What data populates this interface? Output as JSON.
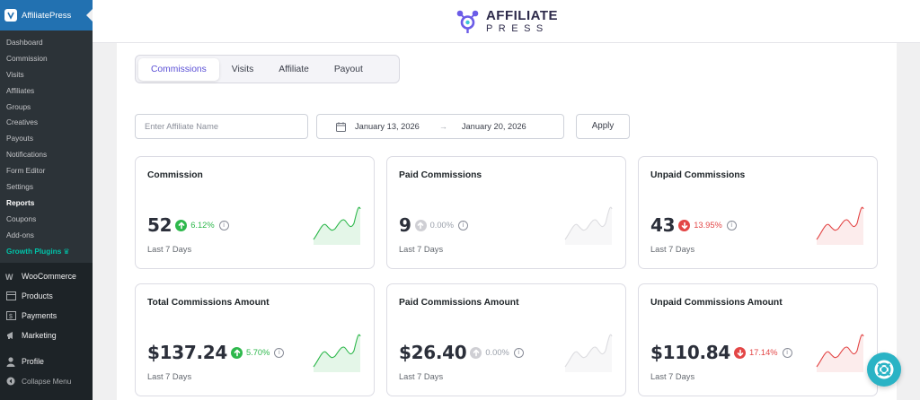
{
  "sidebar": {
    "plugin_title": "AffiliatePress",
    "submenu": [
      {
        "label": "Dashboard"
      },
      {
        "label": "Commission"
      },
      {
        "label": "Visits"
      },
      {
        "label": "Affiliates"
      },
      {
        "label": "Groups"
      },
      {
        "label": "Creatives"
      },
      {
        "label": "Payouts"
      },
      {
        "label": "Notifications"
      },
      {
        "label": "Form Editor"
      },
      {
        "label": "Settings"
      },
      {
        "label": "Reports"
      },
      {
        "label": "Coupons"
      },
      {
        "label": "Add-ons"
      },
      {
        "label": "Growth Plugins"
      }
    ],
    "menu": [
      {
        "label": "WooCommerce",
        "icon": "woocommerce-icon"
      },
      {
        "label": "Products",
        "icon": "products-icon"
      },
      {
        "label": "Payments",
        "icon": "payments-icon"
      },
      {
        "label": "Marketing",
        "icon": "megaphone-icon"
      },
      {
        "label": "Profile",
        "icon": "user-icon"
      },
      {
        "label": "Collapse Menu",
        "icon": "collapse-icon"
      }
    ]
  },
  "header": {
    "brand_line1": "AFFILIATE",
    "brand_line2": "PRESS"
  },
  "tabs": [
    {
      "label": "Commissions",
      "active": true
    },
    {
      "label": "Visits"
    },
    {
      "label": "Affiliate"
    },
    {
      "label": "Payout"
    }
  ],
  "filters": {
    "affiliate_placeholder": "Enter Affiliate Name",
    "start_date": "January 13, 2026",
    "end_date": "January 20, 2026",
    "apply_label": "Apply"
  },
  "cards": [
    {
      "title": "Commission",
      "value": "52",
      "change": "6.12%",
      "trend": "up",
      "period": "Last 7 Days"
    },
    {
      "title": "Paid Commissions",
      "value": "9",
      "change": "0.00%",
      "trend": "flat",
      "period": "Last 7 Days"
    },
    {
      "title": "Unpaid Commissions",
      "value": "43",
      "change": "13.95%",
      "trend": "down",
      "period": "Last 7 Days"
    },
    {
      "title": "Total Commissions Amount",
      "value": "$137.24",
      "change": "5.70%",
      "trend": "up",
      "period": "Last 7 Days"
    },
    {
      "title": "Paid Commissions Amount",
      "value": "$26.40",
      "change": "0.00%",
      "trend": "flat",
      "period": "Last 7 Days"
    },
    {
      "title": "Unpaid Commissions Amount",
      "value": "$110.84",
      "change": "17.14%",
      "trend": "down",
      "period": "Last 7 Days"
    }
  ],
  "colors": {
    "sidebar_bg": "#1d2327",
    "active_plugin_bg": "#2271b1",
    "tab_active": "#5b50d6",
    "up": "#2eb84c",
    "down": "#e34646",
    "flat": "#cfcfd4",
    "fab": "#2ab3c5"
  }
}
